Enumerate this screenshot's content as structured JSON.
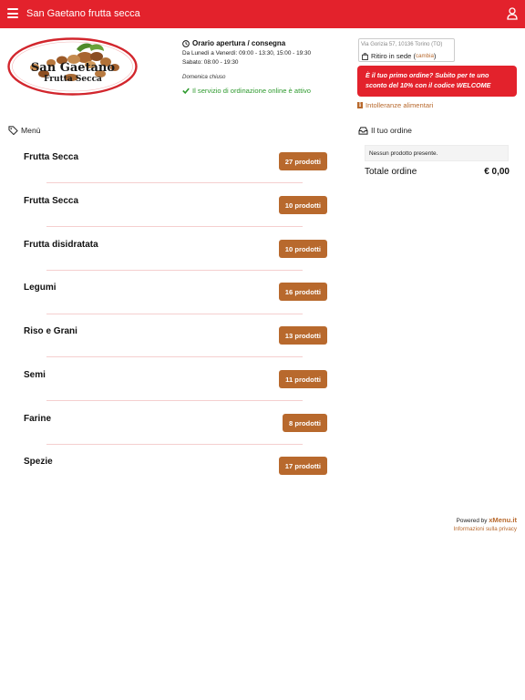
{
  "header": {
    "title": "San Gaetano frutta secca",
    "bg_color": "#e3222c",
    "menu_icon": "hamburger-icon",
    "user_icon": "user-icon"
  },
  "logo": {
    "line1": "San Gaetano",
    "line2": "Frutta Secca"
  },
  "hours": {
    "title": "Orario apertura / consegna",
    "weekday": "Da Lunedì a Venerdì: 09:00 - 13:30, 15:00 - 19:30",
    "saturday": "Sabato: 08:00 - 19:30",
    "closed": "Domenica chiuso",
    "service_status": "Il servizio di ordinazione online è attivo"
  },
  "delivery": {
    "address": "Via Gorizia 57, 10136 Torino (TO)",
    "mode": "Ritiro in sede",
    "change_link": "cambia"
  },
  "promo": {
    "text": "È il tuo primo ordine? Subito per te uno sconto del 10% con il codice WELCOME"
  },
  "intolerances": {
    "label": "Intolleranze alimentari"
  },
  "menu": {
    "heading": "Menù",
    "categories": [
      {
        "name": "Frutta Secca",
        "count": "27 prodotti"
      },
      {
        "name": "Frutta Secca",
        "count": "10 prodotti"
      },
      {
        "name": "Frutta disidratata",
        "count": "10 prodotti"
      },
      {
        "name": "Legumi",
        "count": "16 prodotti"
      },
      {
        "name": "Riso e Grani",
        "count": "13 prodotti"
      },
      {
        "name": "Semi",
        "count": "11 prodotti"
      },
      {
        "name": "Farine",
        "count": "8 prodotti"
      },
      {
        "name": "Spezie",
        "count": "17 prodotti"
      }
    ]
  },
  "order": {
    "heading": "Il tuo ordine",
    "empty_message": "Nessun prodotto presente.",
    "total_label": "Totale ordine",
    "total_value": "€ 0,00"
  },
  "footer": {
    "powered_by": "Powered by",
    "brand": "xMenu.it",
    "privacy": "Informazioni sulla privacy"
  },
  "colors": {
    "accent": "#b8692d",
    "brand_red": "#e3222c",
    "success": "#2e9a2e"
  }
}
